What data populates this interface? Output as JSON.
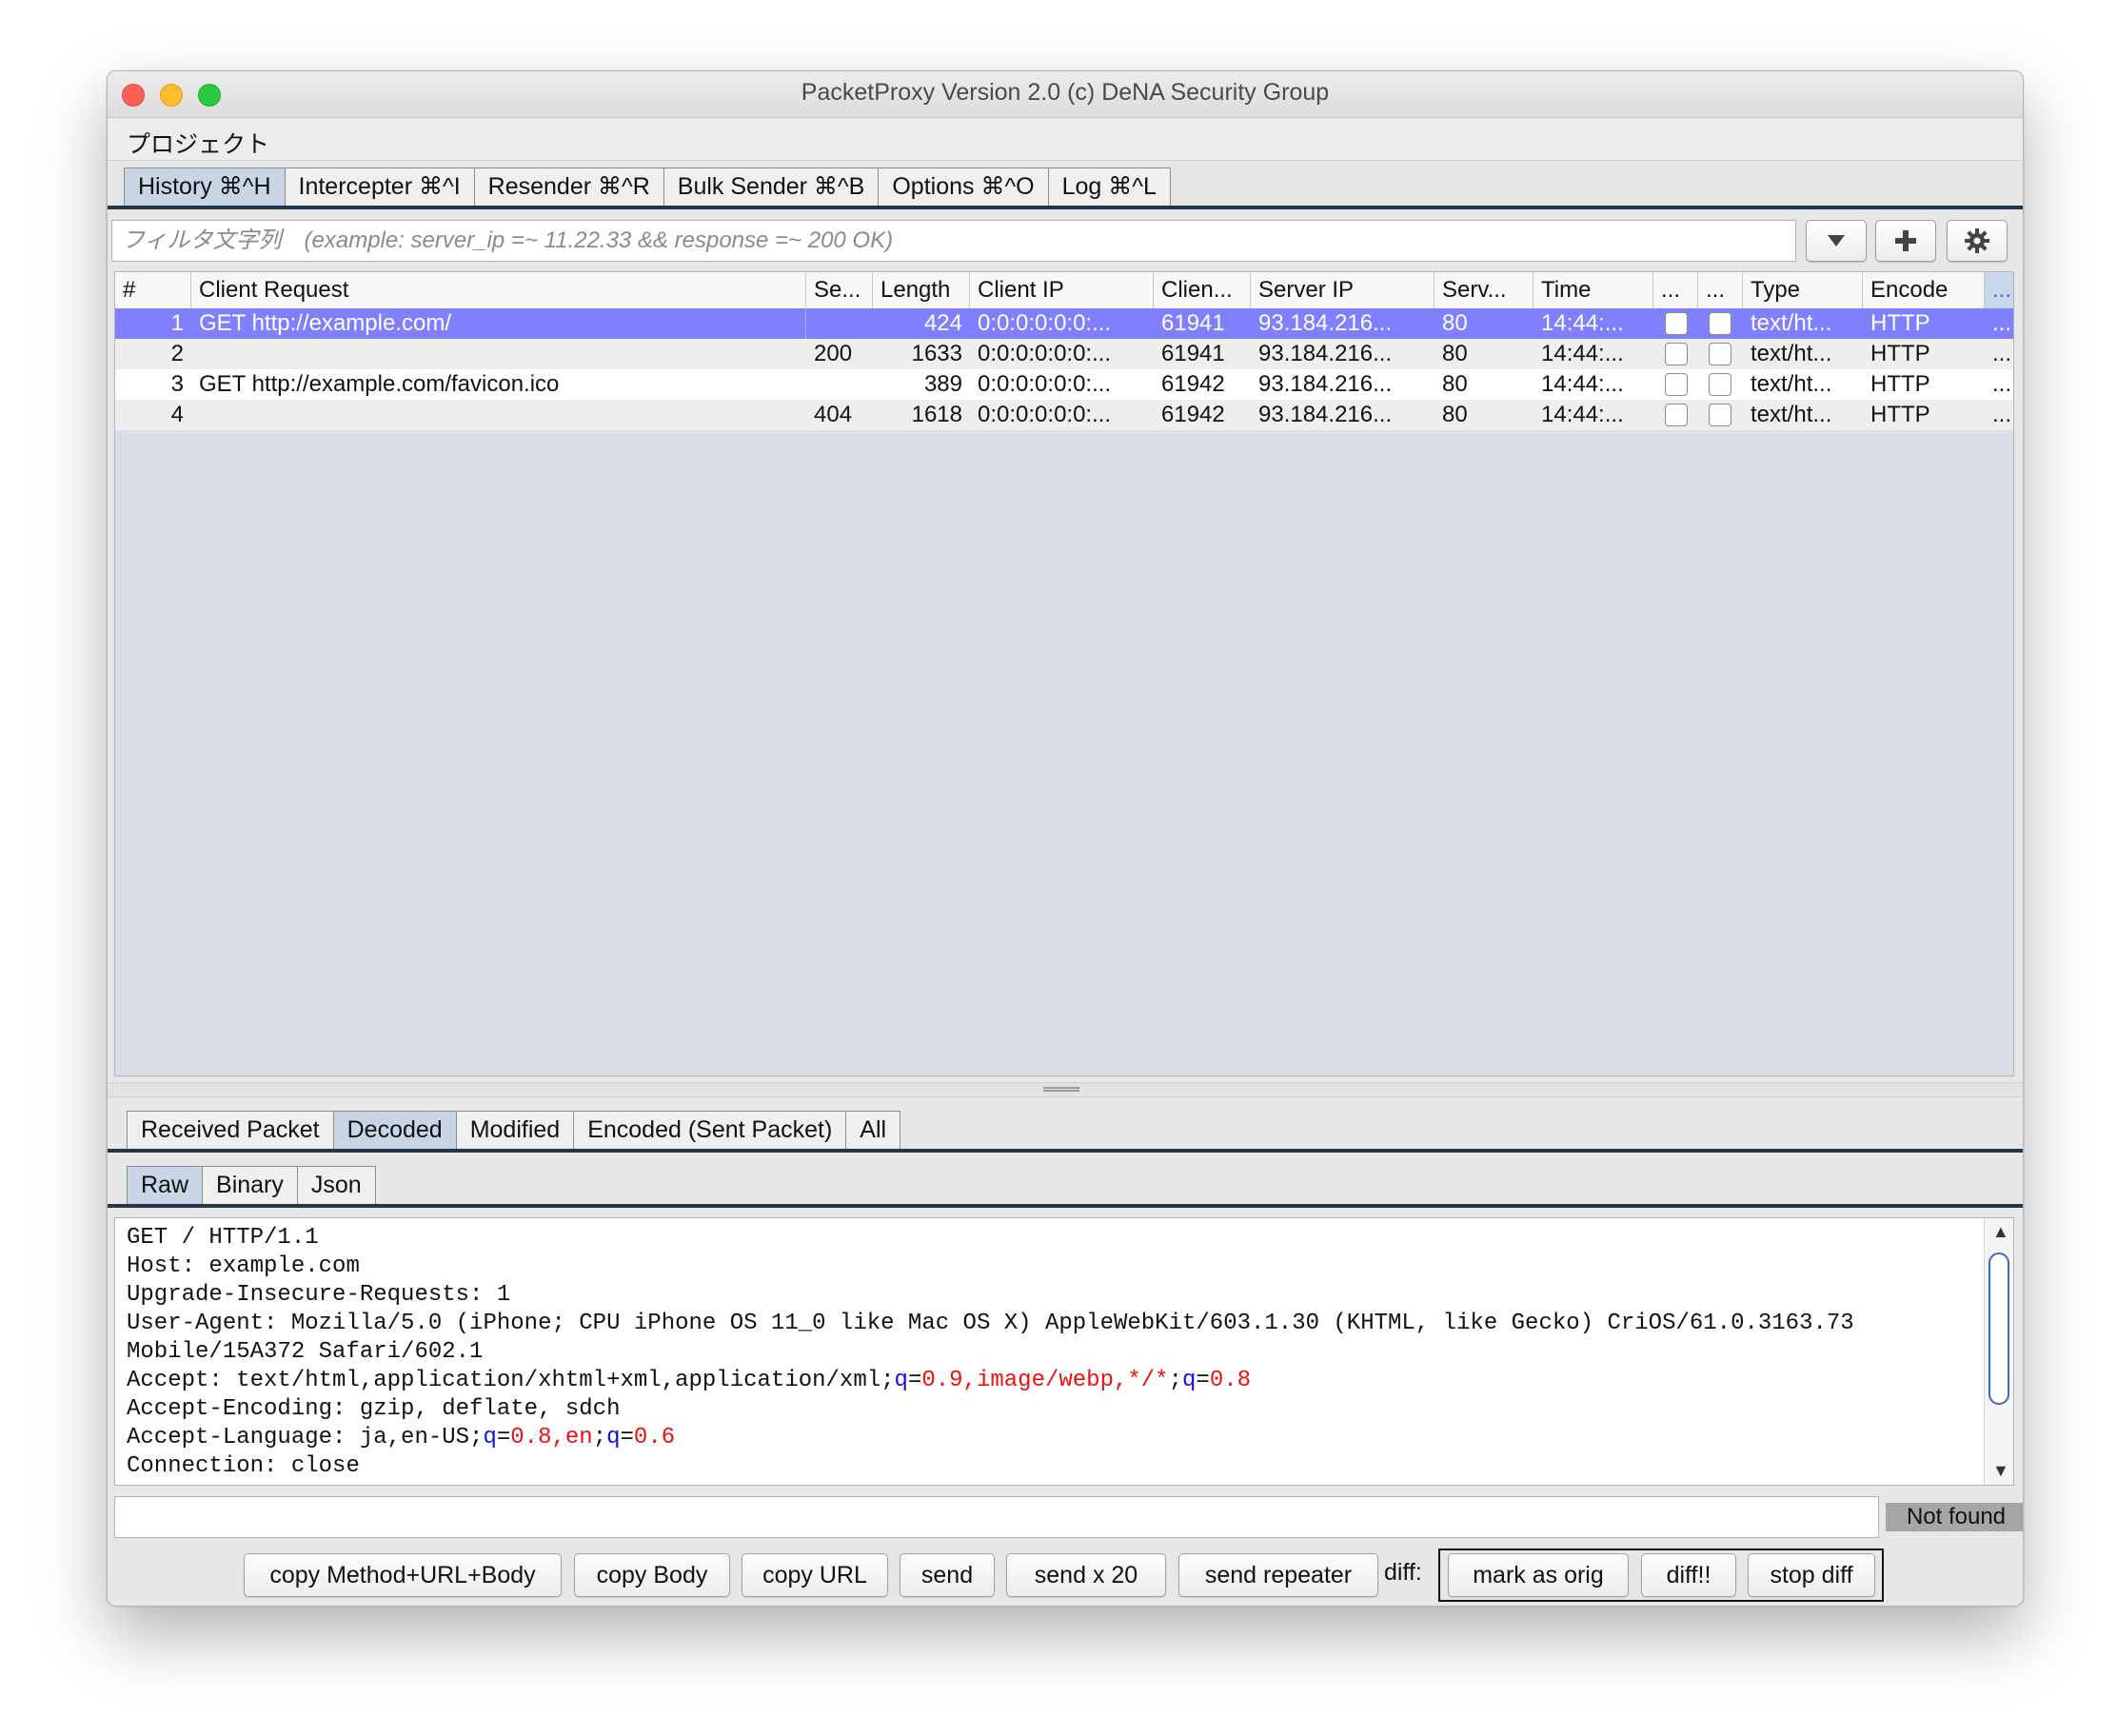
{
  "window": {
    "title": "PacketProxy Version 2.0 (c) DeNA Security Group"
  },
  "menu": {
    "project": "プロジェクト"
  },
  "main_tabs": [
    {
      "label": "History ⌘^H",
      "active": true
    },
    {
      "label": "Intercepter ⌘^I",
      "active": false
    },
    {
      "label": "Resender ⌘^R",
      "active": false
    },
    {
      "label": "Bulk Sender ⌘^B",
      "active": false
    },
    {
      "label": "Options ⌘^O",
      "active": false
    },
    {
      "label": "Log ⌘^L",
      "active": false
    }
  ],
  "filter": {
    "placeholder": "フィルタ文字列　(example: server_ip =~ 11.22.33 && response =~ 200 OK)",
    "icons": [
      "chevron-down-icon",
      "plus-icon",
      "gear-icon"
    ]
  },
  "table": {
    "headers": [
      "#",
      "Client Request",
      "Se...",
      "Length",
      "Client IP",
      "Clien...",
      "Server IP",
      "Serv...",
      "Time",
      "...",
      "...",
      "Type",
      "Encode",
      "..."
    ],
    "rows": [
      {
        "num": "1",
        "request": "GET http://example.com/",
        "status": "",
        "length": "424",
        "client_ip": "0:0:0:0:0:0:...",
        "client_port": "61941",
        "server_ip": "93.184.216...",
        "server_port": "80",
        "time": "14:44:...",
        "type": "text/ht...",
        "encode": "HTTP",
        "more": "...",
        "selected": true
      },
      {
        "num": "2",
        "request": "",
        "status": "200",
        "length": "1633",
        "client_ip": "0:0:0:0:0:0:...",
        "client_port": "61941",
        "server_ip": "93.184.216...",
        "server_port": "80",
        "time": "14:44:...",
        "type": "text/ht...",
        "encode": "HTTP",
        "more": "...",
        "selected": false
      },
      {
        "num": "3",
        "request": "GET http://example.com/favicon.ico",
        "status": "",
        "length": "389",
        "client_ip": "0:0:0:0:0:0:...",
        "client_port": "61942",
        "server_ip": "93.184.216...",
        "server_port": "80",
        "time": "14:44:...",
        "type": "text/ht...",
        "encode": "HTTP",
        "more": "...",
        "selected": false
      },
      {
        "num": "4",
        "request": "",
        "status": "404",
        "length": "1618",
        "client_ip": "0:0:0:0:0:0:...",
        "client_port": "61942",
        "server_ip": "93.184.216...",
        "server_port": "80",
        "time": "14:44:...",
        "type": "text/ht...",
        "encode": "HTTP",
        "more": "...",
        "selected": false
      }
    ]
  },
  "packet_tabs": [
    {
      "label": "Received Packet",
      "active": false
    },
    {
      "label": "Decoded",
      "active": true
    },
    {
      "label": "Modified",
      "active": false
    },
    {
      "label": "Encoded (Sent Packet)",
      "active": false
    },
    {
      "label": "All",
      "active": false
    }
  ],
  "view_tabs": [
    {
      "label": "Raw",
      "active": true
    },
    {
      "label": "Binary",
      "active": false
    },
    {
      "label": "Json",
      "active": false
    }
  ],
  "request_text": {
    "line1": "GET / HTTP/1.1",
    "line2": "Host: example.com",
    "line3": "Upgrade-Insecure-Requests: 1",
    "line4": "User-Agent: Mozilla/5.0 (iPhone; CPU iPhone OS 11_0 like Mac OS X) AppleWebKit/603.1.30 (KHTML, like Gecko) CriOS/61.0.3163.73",
    "line5": "Mobile/15A372 Safari/602.1",
    "accept_prefix": "Accept: text/html,application/xhtml+xml,application/xml;",
    "accept_q1_key": "q",
    "accept_eq1": "=",
    "accept_q1_val": "0.9,image/webp,*/*",
    "accept_semicolon": ";",
    "accept_q2_key": "q",
    "accept_eq2": "=",
    "accept_q2_val": "0.8",
    "line7": "Accept-Encoding: gzip, deflate, sdch",
    "lang_prefix": "Accept-Language: ja,en-US;",
    "lang_q1_key": "q",
    "lang_eq1": "=",
    "lang_q1_val": "0.8,en",
    "lang_semicolon": ";",
    "lang_q2_key": "q",
    "lang_eq2": "=",
    "lang_q2_val": "0.6",
    "line9": "Connection: close"
  },
  "search": {
    "value": "",
    "status": "Not found"
  },
  "buttons": {
    "copy_method_url_body": "copy Method+URL+Body",
    "copy_body": "copy Body",
    "copy_url": "copy URL",
    "send": "send",
    "send_x20": "send x 20",
    "send_repeater": "send repeater",
    "diff_label": "diff:",
    "mark_as_orig": "mark as orig",
    "diff": "diff!!",
    "stop_diff": "stop diff"
  },
  "colors": {
    "selection": "#8080ff",
    "active_tab": "#c7d5e5",
    "tab_underline": "#25364a",
    "syntax_key": "#1010e0",
    "syntax_value": "#ee1010"
  }
}
